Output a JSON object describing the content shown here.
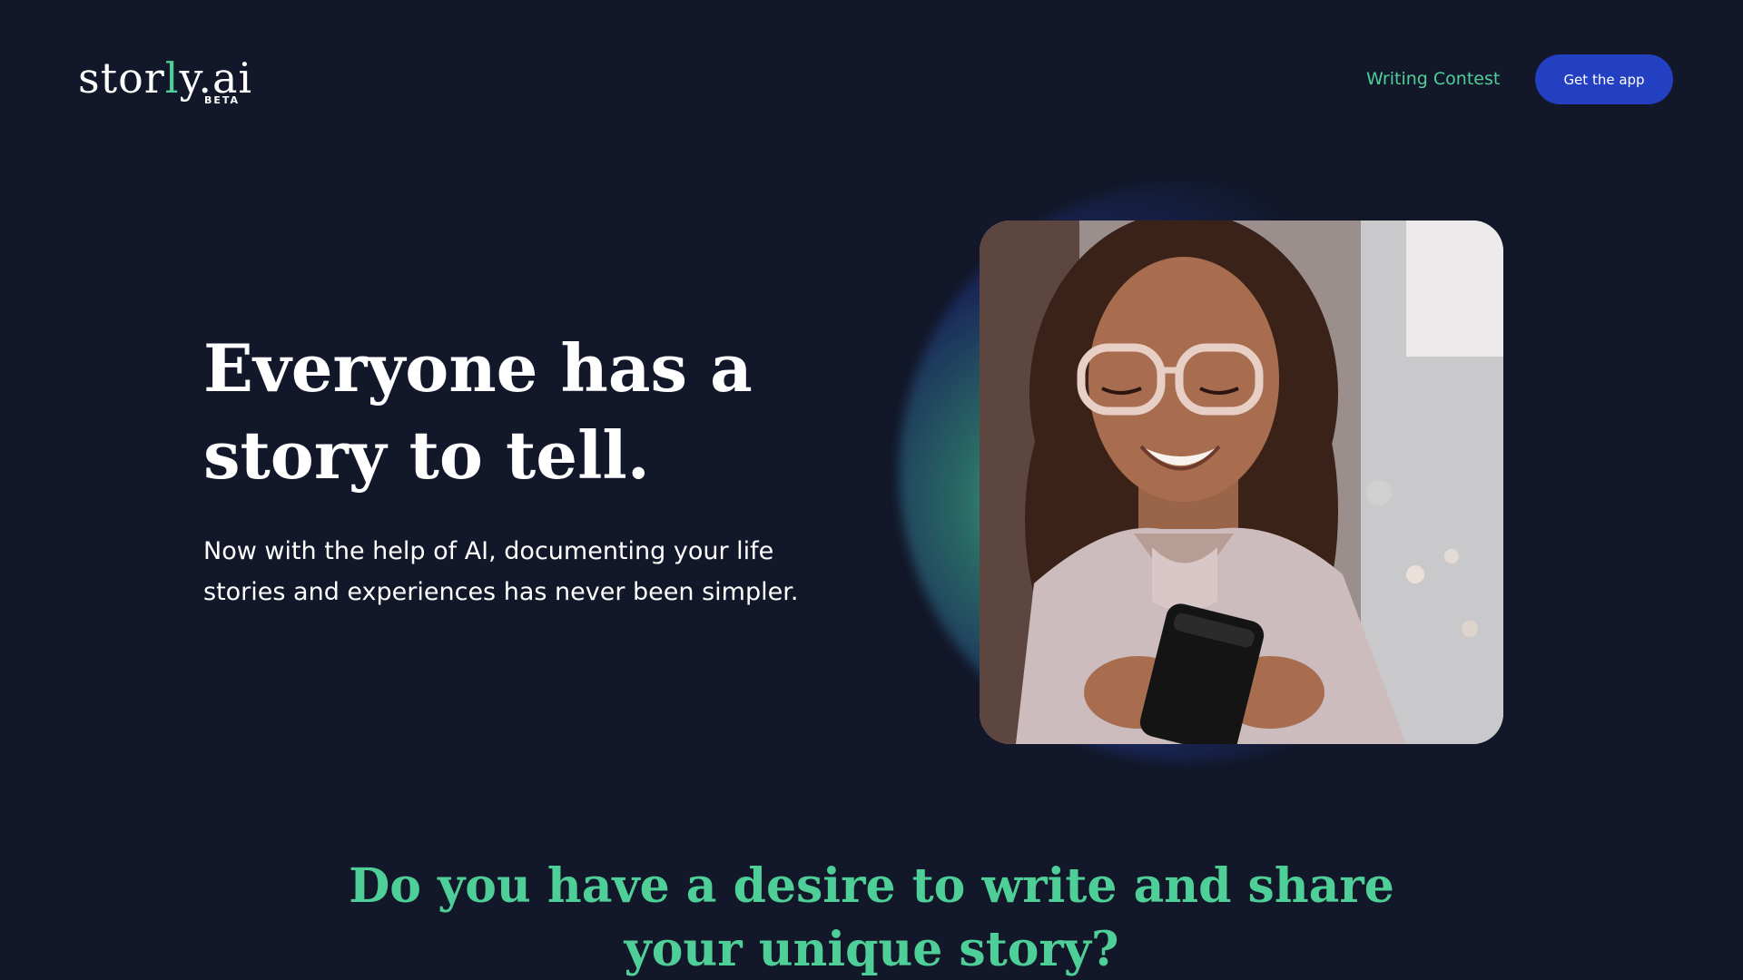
{
  "brand": {
    "logo_prefix": "stor",
    "logo_accent": "l",
    "logo_suffix": "y.ai",
    "badge": "BETA",
    "accent_color": "#4fcf98",
    "background_color": "#121729",
    "button_color": "#2440c2"
  },
  "nav": {
    "writing_contest": "Writing Contest",
    "get_app": "Get the app"
  },
  "hero": {
    "title_line1": "Everyone has a",
    "title_line2": "story to tell.",
    "subtitle": "Now with the help of AI, documenting your life stories and experiences has never been simpler.",
    "image_icon": "woman-smiling-at-phone-photo"
  },
  "section": {
    "heading_line1": "Do you have a desire to write and share",
    "heading_line2": "your unique story?"
  }
}
